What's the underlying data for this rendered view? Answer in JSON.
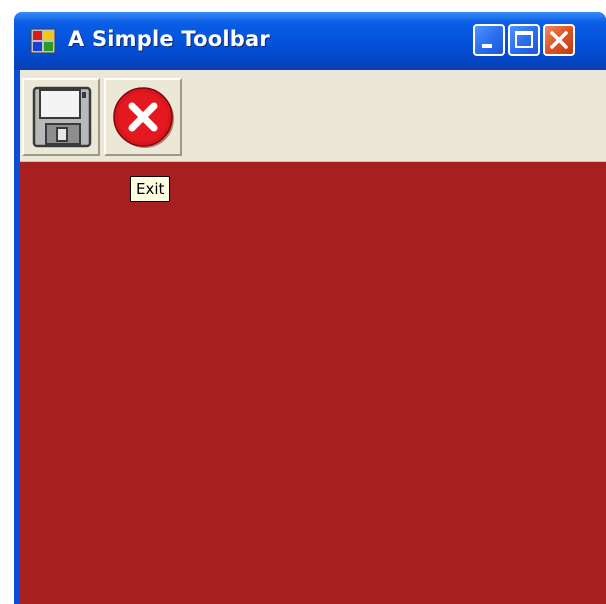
{
  "window": {
    "title": "A Simple Toolbar",
    "client_color": "#a81f20"
  },
  "titlebar": {
    "icons": {
      "app": "application-icon",
      "minimize": "minimize-icon",
      "maximize": "maximize-icon",
      "close": "close-icon"
    }
  },
  "toolbar": {
    "buttons": [
      {
        "name": "save-button",
        "icon": "floppy-disk-icon"
      },
      {
        "name": "exit-button",
        "icon": "exit-x-icon"
      }
    ]
  },
  "tooltip": {
    "text": "Exit"
  }
}
